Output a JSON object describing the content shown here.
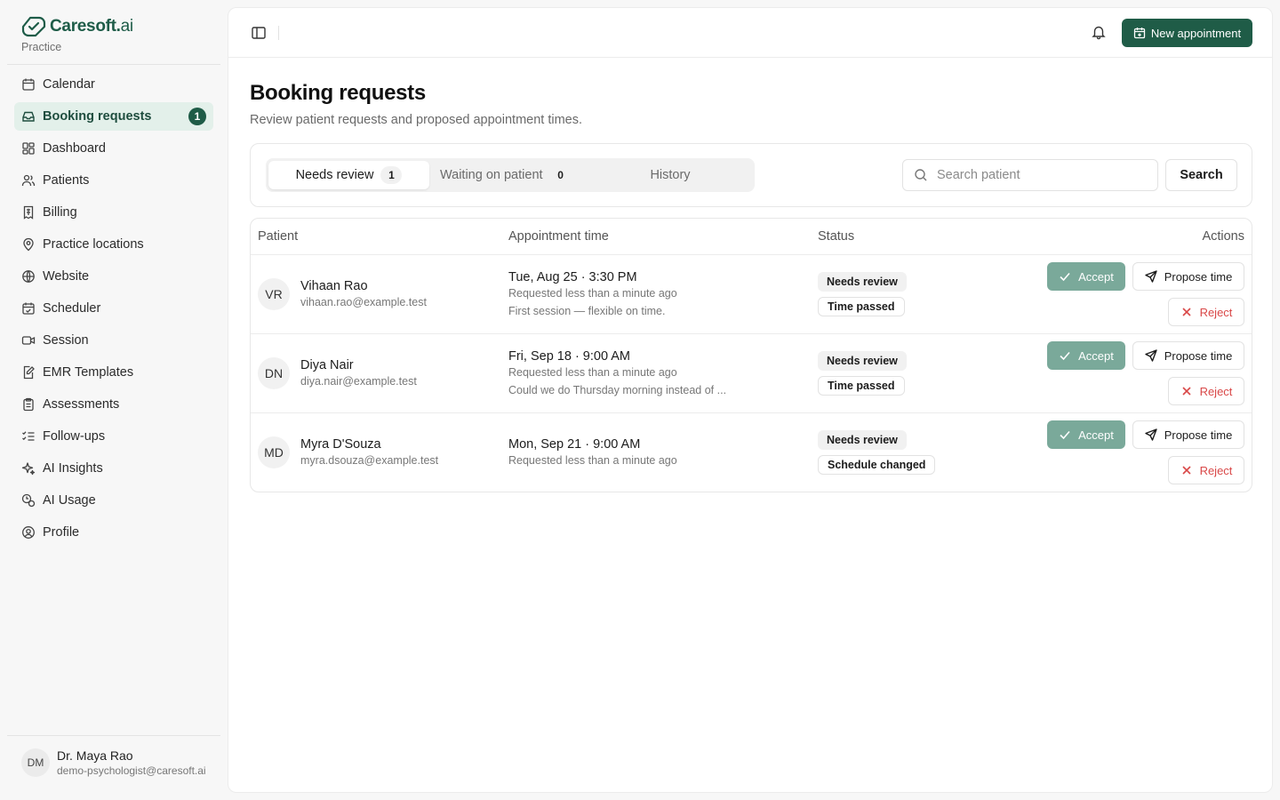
{
  "brand": {
    "name": "Caresoft.",
    "name_suffix": "ai",
    "subtitle": "Practice",
    "color": "#1e5c48"
  },
  "sidebar": {
    "items": [
      {
        "label": "Calendar",
        "icon": "calendar-icon"
      },
      {
        "label": "Booking requests",
        "icon": "inbox-icon",
        "badge": "1",
        "active": true
      },
      {
        "label": "Dashboard",
        "icon": "dashboard-icon"
      },
      {
        "label": "Patients",
        "icon": "users-icon"
      },
      {
        "label": "Billing",
        "icon": "receipt-icon"
      },
      {
        "label": "Practice locations",
        "icon": "map-pin-icon"
      },
      {
        "label": "Website",
        "icon": "globe-icon"
      },
      {
        "label": "Scheduler",
        "icon": "calendar-check-icon"
      },
      {
        "label": "Session",
        "icon": "video-icon"
      },
      {
        "label": "EMR Templates",
        "icon": "file-edit-icon"
      },
      {
        "label": "Assessments",
        "icon": "clipboard-icon"
      },
      {
        "label": "Follow-ups",
        "icon": "list-checks-icon"
      },
      {
        "label": "AI Insights",
        "icon": "sparkles-icon"
      },
      {
        "label": "AI Usage",
        "icon": "usage-icon"
      },
      {
        "label": "Profile",
        "icon": "user-circle-icon"
      }
    ],
    "user": {
      "initials": "DM",
      "name": "Dr. Maya Rao",
      "email": "demo-psychologist@caresoft.ai"
    }
  },
  "topbar": {
    "new_appointment_label": "New appointment"
  },
  "page": {
    "title": "Booking requests",
    "subtitle": "Review patient requests and proposed appointment times."
  },
  "filters": {
    "tabs": [
      {
        "label": "Needs review",
        "count": "1",
        "active": true
      },
      {
        "label": "Waiting on patient",
        "count": "0"
      },
      {
        "label": "History"
      }
    ],
    "search": {
      "placeholder": "Search patient",
      "value": "",
      "button_label": "Search"
    }
  },
  "table": {
    "headers": {
      "patient": "Patient",
      "appointment": "Appointment time",
      "status": "Status",
      "actions": "Actions"
    },
    "action_labels": {
      "accept": "Accept",
      "propose": "Propose time",
      "reject": "Reject"
    },
    "rows": [
      {
        "initials": "VR",
        "name": "Vihaan Rao",
        "email": "vihaan.rao@example.test",
        "time": "Tue, Aug 25 · 3:30 PM",
        "requested": "Requested less than a minute ago",
        "note": "First session — flexible on time.",
        "status": "Needs review",
        "status2": "Time passed"
      },
      {
        "initials": "DN",
        "name": "Diya Nair",
        "email": "diya.nair@example.test",
        "time": "Fri, Sep 18 · 9:00 AM",
        "requested": "Requested less than a minute ago",
        "note": "Could we do Thursday morning instead of ...",
        "status": "Needs review",
        "status2": "Time passed"
      },
      {
        "initials": "MD",
        "name": "Myra D'Souza",
        "email": "myra.dsouza@example.test",
        "time": "Mon, Sep 21 · 9:00 AM",
        "requested": "Requested less than a minute ago",
        "note": "",
        "status": "Needs review",
        "status2": "Schedule changed"
      }
    ]
  },
  "colors": {
    "primary": "#1f5c47",
    "accept_muted": "#7aa99a",
    "reject": "#d94848",
    "active_nav_bg": "#e3f0ea"
  }
}
